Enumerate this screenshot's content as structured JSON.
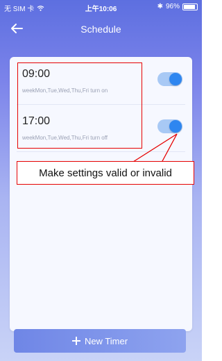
{
  "status_bar": {
    "carrier": "无 SIM 卡",
    "time": "上午10:06",
    "battery": "96%"
  },
  "header": {
    "title": "Schedule"
  },
  "timers": [
    {
      "time": "09:00",
      "description": "weekMon,Tue,Wed,Thu,Fri turn on",
      "enabled": true
    },
    {
      "time": "17:00",
      "description": "weekMon,Tue,Wed,Thu,Fri turn off",
      "enabled": true
    }
  ],
  "annotation": {
    "text": "Make settings valid or invalid"
  },
  "new_timer_button": {
    "label": "New Timer"
  },
  "colors": {
    "accent": "#2e86f0",
    "highlight": "#e60000"
  }
}
